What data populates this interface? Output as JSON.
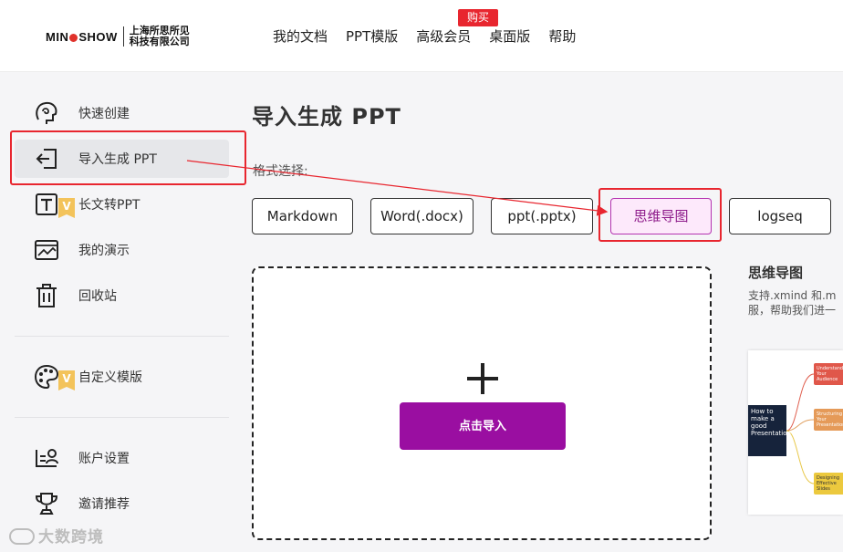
{
  "brand": {
    "logo_text_pre": "MIN",
    "logo_text_post": "SHOW",
    "company_line1": "上海所思所见",
    "company_line2": "科技有限公司"
  },
  "nav": {
    "items": [
      "我的文档",
      "PPT模版",
      "高级会员",
      "桌面版",
      "帮助"
    ],
    "badge": "购买"
  },
  "sidebar": {
    "items": [
      {
        "label": "快速创建",
        "icon": "brain-icon"
      },
      {
        "label": "导入生成 PPT",
        "icon": "import-icon",
        "active": true
      },
      {
        "label": "长文转PPT",
        "icon": "text-doc-icon",
        "vip": "V"
      },
      {
        "label": "我的演示",
        "icon": "presentation-icon"
      },
      {
        "label": "回收站",
        "icon": "trash-icon"
      },
      {
        "label": "自定义模版",
        "icon": "palette-icon",
        "vip": "V"
      },
      {
        "label": "账户设置",
        "icon": "account-settings-icon"
      },
      {
        "label": "邀请推荐",
        "icon": "trophy-icon"
      }
    ]
  },
  "main": {
    "title": "导入生成 PPT",
    "format_label": "格式选择:",
    "formats": [
      "Markdown",
      "Word(.docx)",
      "ppt(.pptx)",
      "思维导图",
      "logseq"
    ],
    "active_format": "思维导图",
    "import_button": "点击导入"
  },
  "right_panel": {
    "title": "思维导图",
    "desc_line1": "支持.xmind 和.m",
    "desc_line2": "服，帮助我们进一",
    "preview": {
      "root": "How to make a good Presentation",
      "nodes": [
        "Understand Your Audience",
        "Structuring Your Presentation",
        "Designing Effective Slides"
      ]
    }
  },
  "watermark": "大数跨境",
  "colors": {
    "accent": "#9a0ea1",
    "highlight": "#e8262f",
    "active_format_bg": "#fde9fb",
    "badge": "#e8262f"
  }
}
